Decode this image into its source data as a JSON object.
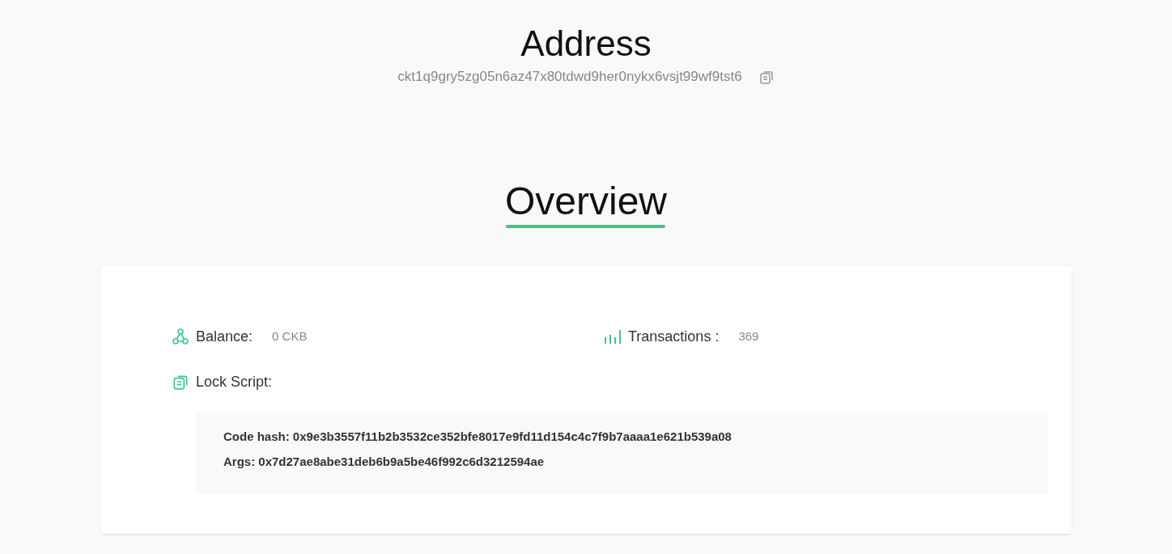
{
  "header": {
    "title": "Address",
    "address": "ckt1q9gry5zg05n6az47x80tdwd9her0nykx6vsjt99wf9tst6"
  },
  "section_title": "Overview",
  "overview": {
    "balance": {
      "label": "Balance:",
      "value": "0 CKB"
    },
    "transactions": {
      "label": "Transactions :",
      "value": "369"
    },
    "lock_script": {
      "label": "Lock Script:",
      "lines": [
        "Code hash: 0x9e3b3557f11b2b3532ce352bfe8017e9fd11d154c4c7f9b7aaaa1e621b539a08",
        "Args: 0x7d27ae8abe31deb6b9a5be46f992c6d3212594ae"
      ]
    }
  }
}
